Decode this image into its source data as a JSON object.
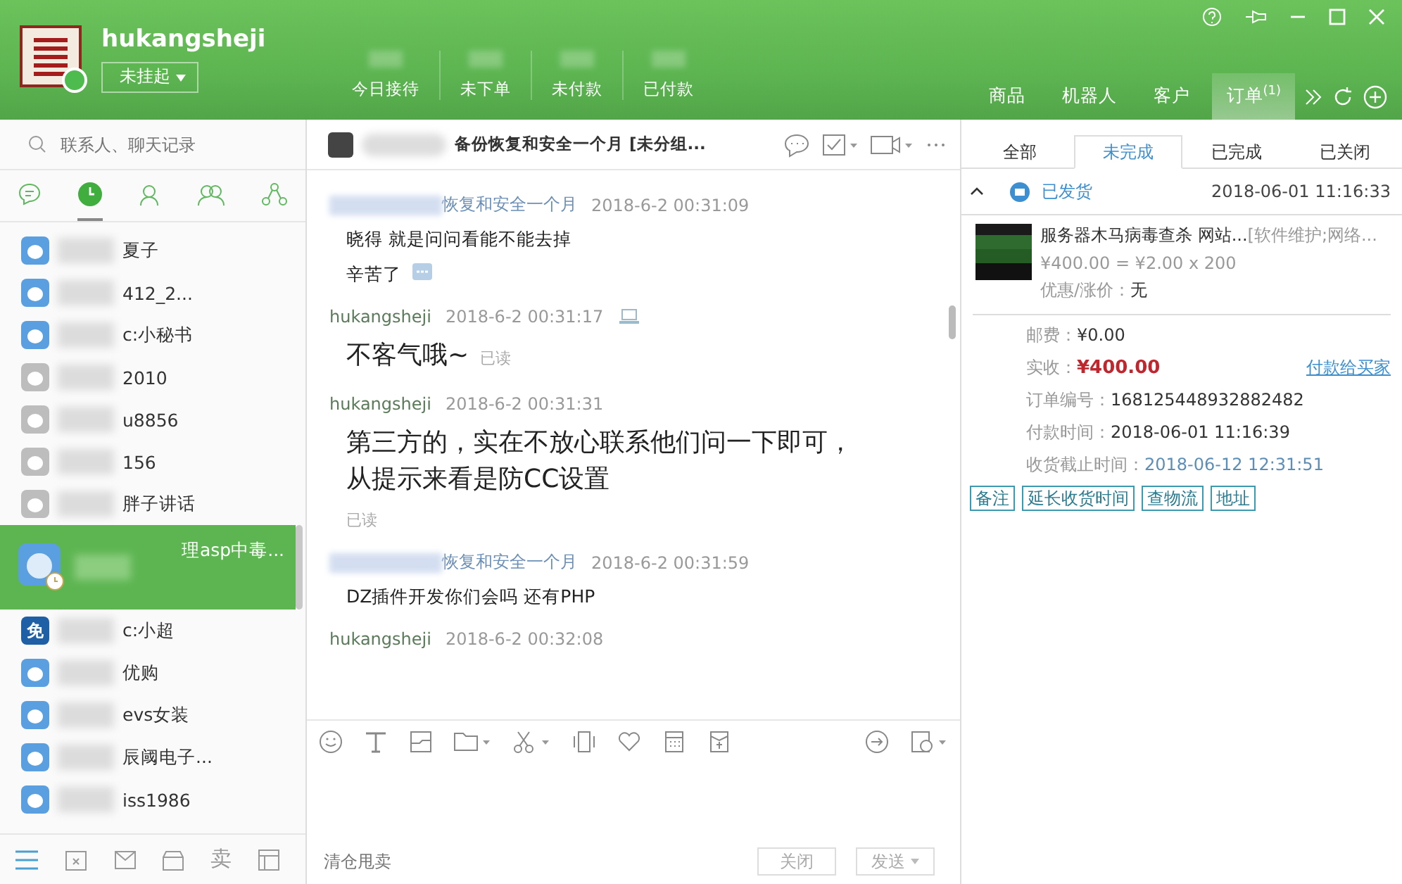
{
  "account": {
    "name": "hukangsheji",
    "status": "未挂起"
  },
  "stats": [
    "今日接待",
    "未下单",
    "未付款",
    "已付款"
  ],
  "app_tabs": [
    {
      "label": "商品",
      "selected": false
    },
    {
      "label": "机器人",
      "selected": false
    },
    {
      "label": "客户",
      "selected": false
    },
    {
      "label": "订单",
      "badge": "(1)",
      "selected": true
    }
  ],
  "sidebar": {
    "search": {
      "placeholder": "联系人、聊天记录"
    },
    "tabs": [
      {
        "kind": "chat",
        "selected": false
      },
      {
        "kind": "recent",
        "selected": true
      },
      {
        "kind": "contact",
        "selected": false
      },
      {
        "kind": "group",
        "selected": false
      },
      {
        "kind": "team",
        "selected": false
      }
    ],
    "contacts": [
      {
        "name": "夏子",
        "online": true,
        "selected": false,
        "kind": "contact"
      },
      {
        "name": "412_2...",
        "online": true,
        "selected": false,
        "kind": "contact"
      },
      {
        "name": "c:小秘书",
        "online": true,
        "selected": false,
        "kind": "contact"
      },
      {
        "name": "2010",
        "online": false,
        "selected": false,
        "kind": "contact"
      },
      {
        "name": "u8856",
        "online": false,
        "selected": false,
        "kind": "contact"
      },
      {
        "name": "156",
        "online": false,
        "selected": false,
        "kind": "contact"
      },
      {
        "name": "胖子讲话",
        "online": false,
        "selected": false,
        "kind": "contact"
      },
      {
        "name": "理asp中毒...",
        "online": true,
        "selected": true,
        "kind": "contact"
      },
      {
        "name": "c:小超",
        "selected": false,
        "kind": "free",
        "badge": "免"
      },
      {
        "name": "优购",
        "online": true,
        "selected": false,
        "kind": "contact"
      },
      {
        "name": "evs女装",
        "online": true,
        "selected": false,
        "kind": "contact"
      },
      {
        "name": "辰阈电子...",
        "online": true,
        "selected": false,
        "kind": "contact"
      },
      {
        "name": "iss1986",
        "online": true,
        "selected": false,
        "kind": "contact"
      }
    ],
    "bottom_label": "卖"
  },
  "chat": {
    "title": "备份恢复和安全一个月 [未分组...",
    "messages": [
      {
        "kind": "incoming",
        "sender": "恢复和安全一个月",
        "time": "2018-6-2 00:31:09",
        "large": false,
        "lines": [
          "晓得 就是问问看能不能去掉",
          "辛苦了"
        ]
      },
      {
        "kind": "outgoing",
        "sender": "hukangsheji",
        "time": "2018-6-2 00:31:17",
        "large": true,
        "lines": [
          "不客气哦~"
        ],
        "read": "已读"
      },
      {
        "kind": "outgoing",
        "sender": "hukangsheji",
        "time": "2018-6-2 00:31:31",
        "large": true,
        "lines": [
          "第三方的，实在不放心联系他们问一下即可，从提示来看是防CC设置"
        ],
        "read": "已读"
      },
      {
        "kind": "incoming",
        "sender": "恢复和安全一个月",
        "time": "2018-6-2 00:31:59",
        "large": false,
        "lines": [
          "DZ插件开发你们会吗  还有PHP"
        ]
      },
      {
        "kind": "outgoing",
        "sender": "hukangsheji",
        "time": "2018-6-2 00:32:08"
      }
    ],
    "input": {
      "placeholder": "清仓甩卖"
    },
    "buttons": [
      {
        "label": "关闭",
        "dropdown": false
      },
      {
        "label": "发送",
        "dropdown": true
      }
    ]
  },
  "orders": {
    "tabs": [
      {
        "label": "全部",
        "selected": false
      },
      {
        "label": "未完成",
        "selected": true
      },
      {
        "label": "已完成",
        "selected": false
      },
      {
        "label": "已关闭",
        "selected": false
      }
    ],
    "order": {
      "expanded": true,
      "status": "已发货",
      "time": "2018-06-01 11:16:33",
      "product": {
        "title": "服务器木马病毒查杀 网站...",
        "category": "[软件维护;网络...",
        "price": "¥400.00 = ¥2.00 x 200",
        "discount_label": "优惠/涨价：",
        "discount": "无"
      },
      "fields": [
        {
          "label": "邮费：",
          "value": "¥0.00",
          "kind": "plain"
        },
        {
          "label": "实收：",
          "value": "¥400.00",
          "kind": "amount",
          "link": "付款给买家"
        },
        {
          "label": "订单编号：",
          "value": "168125448932882482",
          "kind": "plain"
        },
        {
          "label": "付款时间：",
          "value": "2018-06-01 11:16:39",
          "kind": "plain"
        },
        {
          "label": "收货截止时间：",
          "value": "2018-06-12 12:31:51",
          "kind": "deadline"
        }
      ],
      "actions": [
        "备注",
        "延长收货时间",
        "查物流",
        "地址"
      ]
    }
  }
}
